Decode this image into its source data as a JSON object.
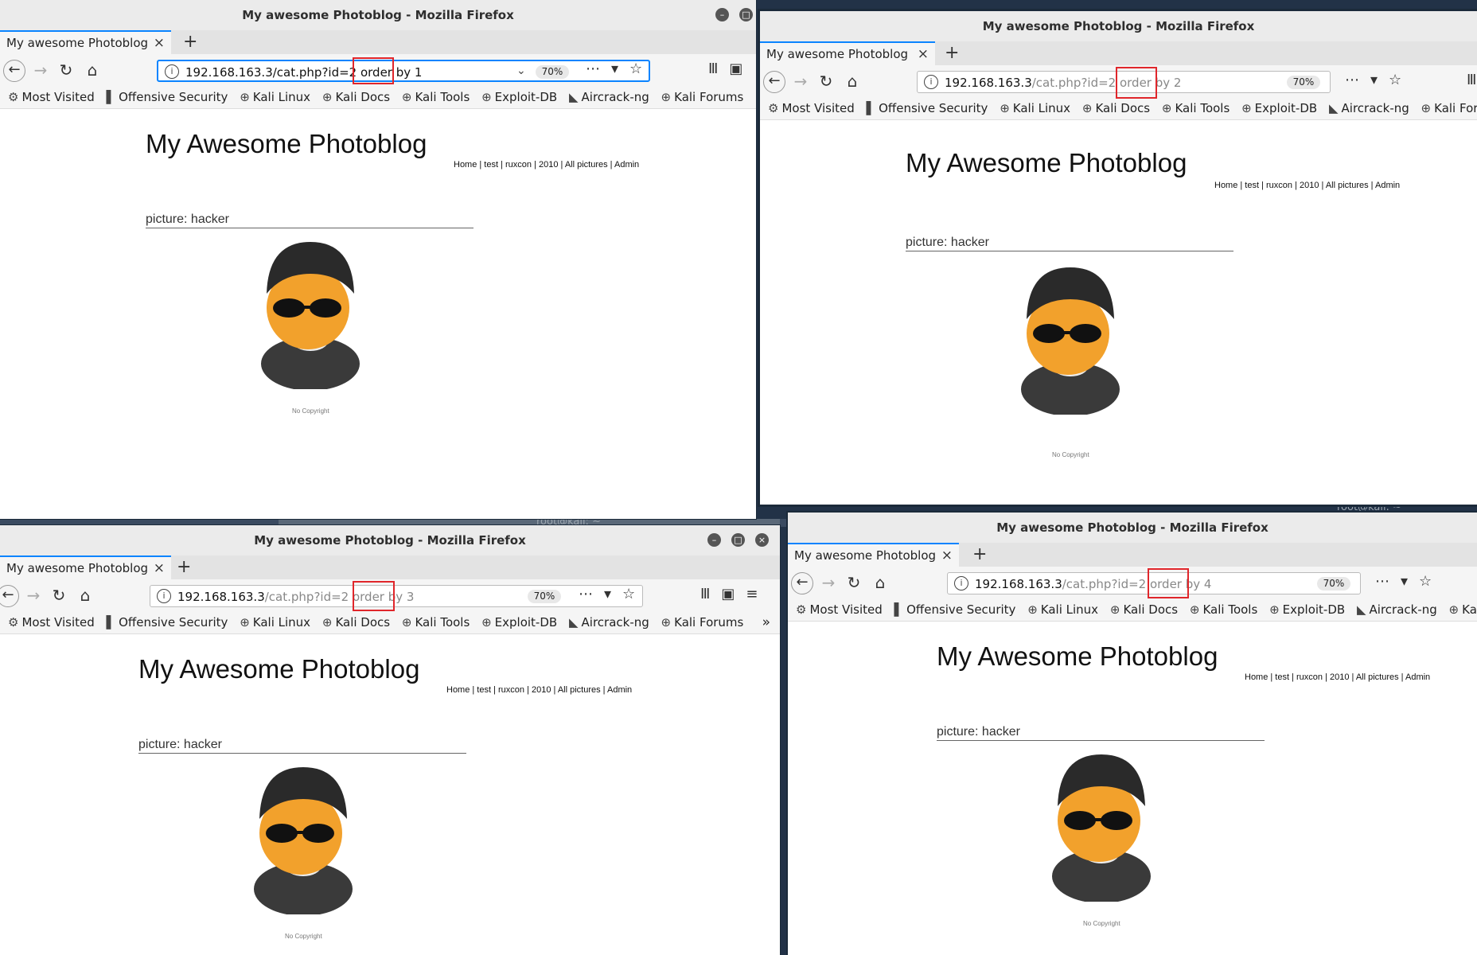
{
  "windows": [
    {
      "title": "My awesome Photoblog - Mozilla Firefox",
      "tab_label": "My awesome Photoblog",
      "url_host": "192.168.163.3",
      "url_rest": "/cat.php?id=2 order",
      "url_inject": " by 1",
      "zoom": "70%",
      "page_title": "My Awesome Photoblog",
      "nav": "Home |  test |  ruxcon |  2010 |  All pictures |  Admin",
      "picture_label": "picture: hacker",
      "copyright": "No Copyright"
    },
    {
      "title": "My awesome Photoblog - Mozilla Firefox",
      "tab_label": "My awesome Photoblog",
      "url_host": "192.168.163.3",
      "url_rest": "/cat.php?id=2 order",
      "url_inject": " by 2",
      "zoom": "70%",
      "page_title": "My Awesome Photoblog",
      "nav": "Home |  test |  ruxcon |  2010 |  All pictures |  Admin",
      "picture_label": "picture: hacker",
      "copyright": "No Copyright"
    },
    {
      "title": "My awesome Photoblog - Mozilla Firefox",
      "tab_label": "My awesome Photoblog",
      "url_host": "192.168.163.3",
      "url_rest": "/cat.php?id=2 order",
      "url_inject": " by 3",
      "zoom": "70%",
      "page_title": "My Awesome Photoblog",
      "nav": "Home |  test |  ruxcon |  2010 |  All pictures |  Admin",
      "picture_label": "picture: hacker",
      "copyright": "No Copyright"
    },
    {
      "title": "My awesome Photoblog - Mozilla Firefox",
      "tab_label": "My awesome Photoblog",
      "url_host": "192.168.163.3",
      "url_rest": "/cat.php?id=2 order",
      "url_inject": " by 4",
      "zoom": "70%",
      "page_title": "My Awesome Photoblog",
      "nav": "Home |  test |  ruxcon |  2010 |  All pictures |  Admin",
      "picture_label": "picture: hacker",
      "copyright": "No Copyright"
    }
  ],
  "bookmarks": [
    "Most Visited",
    "Offensive Security",
    "Kali Linux",
    "Kali Docs",
    "Kali Tools",
    "Exploit-DB",
    "Aircrack-ng",
    "Kali Forums"
  ],
  "terminal_text": "root@kali: ~",
  "colors": {
    "accent": "#0a84ff",
    "highlight": "#e0262b"
  }
}
